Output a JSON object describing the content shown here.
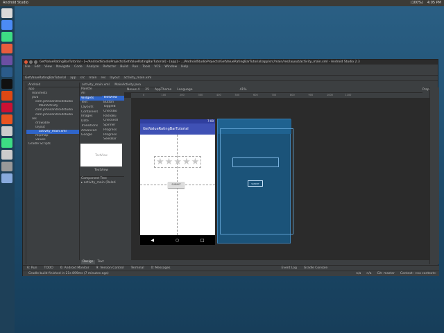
{
  "topbar": {
    "app": "Android Studio",
    "tray": [
      "(100%)",
      "4:05 PM"
    ]
  },
  "window": {
    "title": "GetValueRatingBarTutorial - [~/AndroidStudioProjects/GetValueRatingBarTutorial] - [app] - .../AndroidStudioProjects/GetValueRatingBarTutorial/app/src/main/res/layout/activity_main.xml - Android Studio 2.3",
    "menu": [
      "File",
      "Edit",
      "View",
      "Navigate",
      "Code",
      "Analyze",
      "Refactor",
      "Build",
      "Run",
      "Tools",
      "VCS",
      "Window",
      "Help"
    ],
    "nav": [
      "GetValueRatingBarTutorial",
      "app",
      "src",
      "main",
      "res",
      "layout",
      "activity_main.xml"
    ]
  },
  "project": {
    "header": "Android",
    "tree": [
      "app",
      "manifests",
      "java",
      "com.johnsandroidstudio",
      "MainActivity",
      "com.johnsandroidstudio",
      "com.johnsandroidstudio",
      "res",
      "drawable",
      "layout",
      "activity_main.xml",
      "mipmap",
      "values",
      "Gradle Scripts"
    ],
    "selected_index": 10
  },
  "editor_tabs": [
    "activity_main.xml",
    "MainActivity.java"
  ],
  "palette": {
    "header": "Palette",
    "categories": [
      "All",
      "Widgets",
      "Text",
      "Layouts",
      "Containers",
      "Images",
      "Date",
      "Transitions",
      "Advanced",
      "Google"
    ],
    "selected_category": 1,
    "widgets": [
      "TextView",
      "Button",
      "ToggleB",
      "CheckBo",
      "RadioBu",
      "CheckedT",
      "Spinner",
      "Progress",
      "Progress",
      "SeekBar"
    ],
    "selected_widget": 0,
    "preview_text": "TextView",
    "preview_label": "TextView"
  },
  "component_tree": {
    "header": "Component Tree",
    "root": "activity_main (Relati"
  },
  "design_tabs": [
    "Design",
    "Text"
  ],
  "design_toolbar": [
    "Nexus 4",
    "25",
    "AppTheme",
    "Language",
    "41%"
  ],
  "properties_label": "Properties",
  "ruler_ticks": [
    "0",
    "100",
    "200",
    "300",
    "400",
    "500",
    "600",
    "700",
    "800",
    "900",
    "1000",
    "1100"
  ],
  "device": {
    "time": "7:00",
    "app_title": "GetValueRatingBarTutorial",
    "stars": 5,
    "button": "SUBMIT",
    "nav": [
      "◀",
      "○",
      "□"
    ]
  },
  "blueprint": {
    "button": "SUBMIT"
  },
  "bottom_tools": [
    "6: Run",
    "TODO",
    "6: Android Monitor",
    "9: Version Control",
    "Terminal",
    "0: Messages",
    "Event Log",
    "Gradle Console"
  ],
  "status": {
    "message": "Gradle build finished in 21s 899ms (7 minutes ago)",
    "right": [
      "n/a",
      "n/a",
      "Git: master",
      "Context: <no context>"
    ]
  },
  "colors": {
    "app_bar": "#3f51b5",
    "status_bar": "#303f9f",
    "blueprint": "#1b5379",
    "selection": "#2f65ca"
  }
}
